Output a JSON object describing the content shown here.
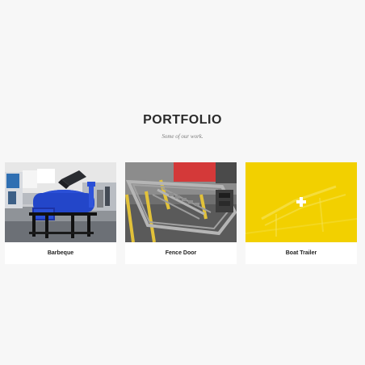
{
  "portfolio": {
    "title": "PORTFOLIO",
    "subtitle": "Some of our work.",
    "items": [
      {
        "label": "Barbeque"
      },
      {
        "label": "Fence Door"
      },
      {
        "label": "Boat Trailer"
      }
    ]
  },
  "colors": {
    "background": "#f7f7f7",
    "overlay": "#f2d000",
    "text": "#222222"
  },
  "icons": {
    "overlay_icon": "plus-icon"
  }
}
